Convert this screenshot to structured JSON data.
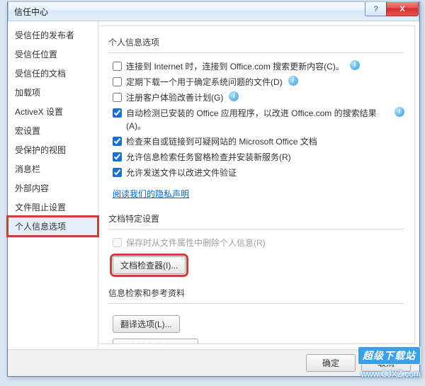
{
  "window": {
    "title": "信任中心",
    "help_label": "?",
    "close_label": "X"
  },
  "sidebar": {
    "items": [
      {
        "label": "受信任的发布者"
      },
      {
        "label": "受信任位置"
      },
      {
        "label": "受信任的文档"
      },
      {
        "label": "加载项"
      },
      {
        "label": "ActiveX 设置"
      },
      {
        "label": "宏设置"
      },
      {
        "label": "受保护的视图"
      },
      {
        "label": "消息栏"
      },
      {
        "label": "外部内容"
      },
      {
        "label": "文件阻止设置"
      },
      {
        "label": "个人信息选项"
      }
    ],
    "selected_index": 10
  },
  "sections": {
    "privacy": {
      "header": "个人信息选项",
      "opts": [
        {
          "checked": false,
          "label": "连接到 Internet 时，连接到 Office.com 搜索更新内容(C)。",
          "info": true
        },
        {
          "checked": false,
          "label": "定期下载一个用于确定系统问题的文件(D)",
          "info": true
        },
        {
          "checked": false,
          "label": "注册客户体验改善计划(G)",
          "info": true
        },
        {
          "checked": true,
          "label": "自动检测已安装的 Office 应用程序，以改进 Office.com 的搜索结果(A)。",
          "info": true
        },
        {
          "checked": true,
          "label": "检查来自或链接到可疑网站的 Microsoft Office 文档",
          "info": false
        },
        {
          "checked": true,
          "label": "允许信息检索任务窗格检查并安装新服务(R)",
          "info": false
        },
        {
          "checked": true,
          "label": "允许发送文件以改进文件验证",
          "info": false
        }
      ],
      "link": "阅读我们的隐私声明"
    },
    "doc": {
      "header": "文档特定设置",
      "opt": {
        "checked": false,
        "label": "保存时从文件属性中删除个人信息(R)",
        "disabled": true
      },
      "button": "文档检查器(I)..."
    },
    "research": {
      "header": "信息检索和参考资料",
      "btn1": "翻译选项(L)...",
      "btn2": "信息检索选项(H)..."
    }
  },
  "footer": {
    "ok": "确定",
    "cancel": "取消"
  },
  "watermark": {
    "badge": "超级下载站",
    "url": "www.CJXZ.com"
  }
}
